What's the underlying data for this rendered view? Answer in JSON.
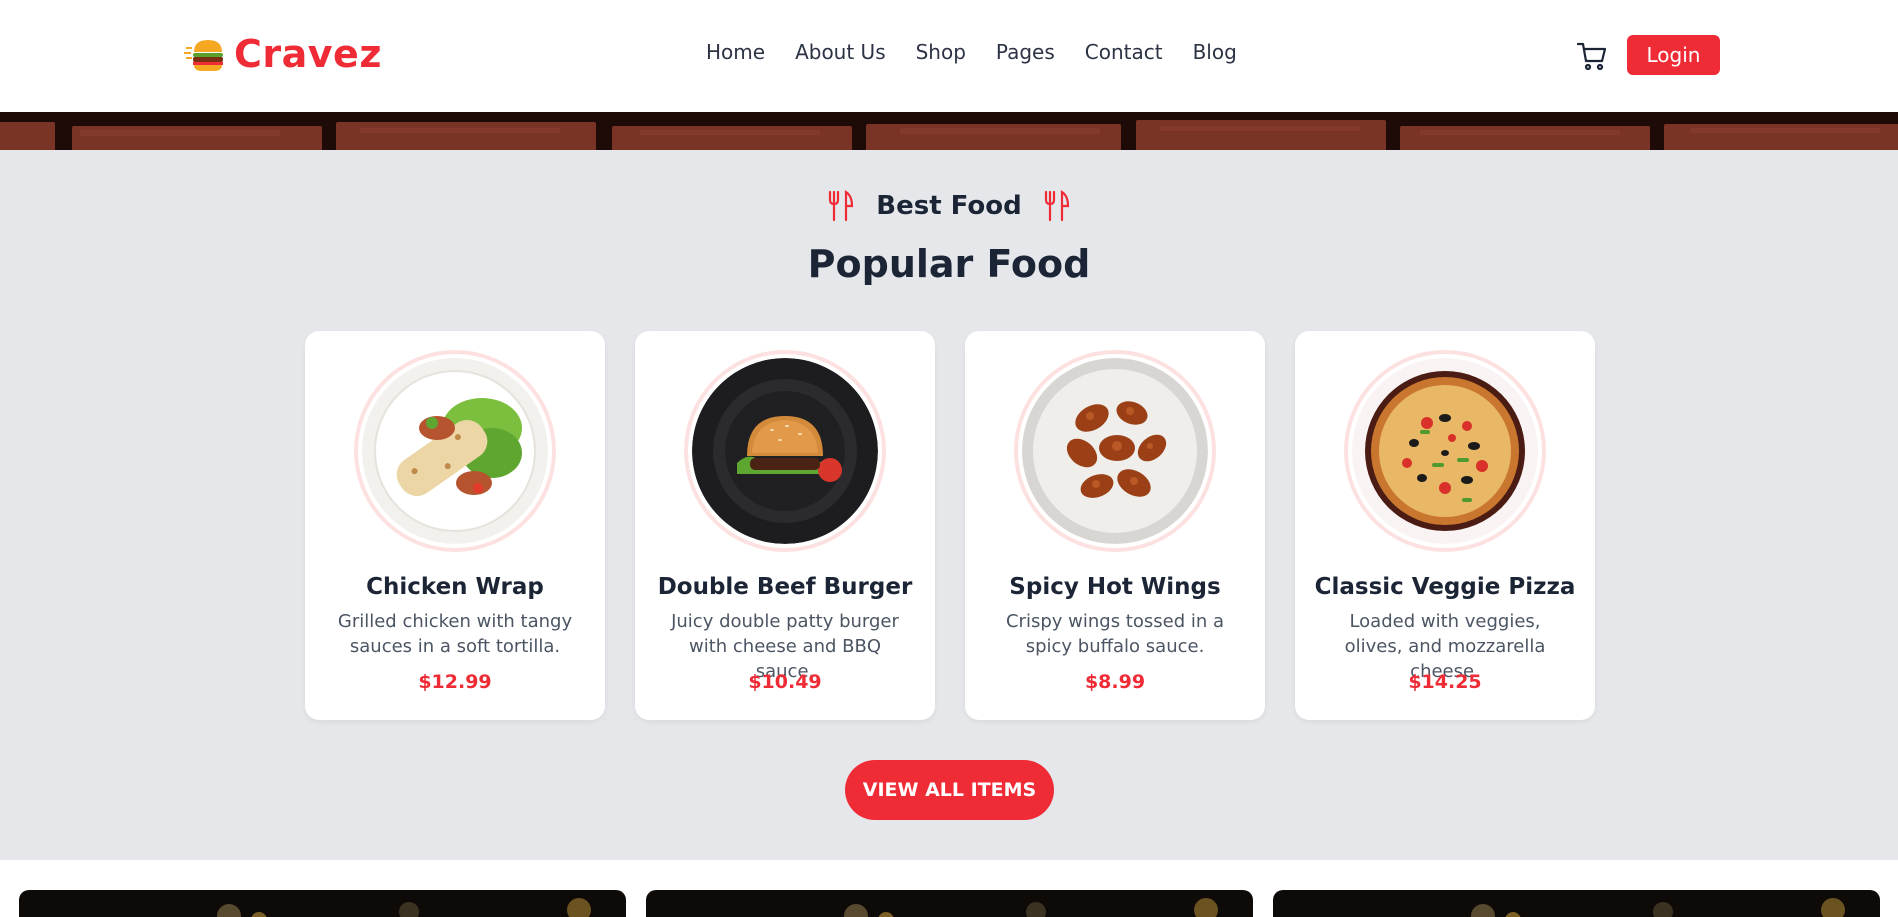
{
  "brand": {
    "name": "Cravez"
  },
  "nav": {
    "items": [
      "Home",
      "About Us",
      "Shop",
      "Pages",
      "Contact",
      "Blog"
    ]
  },
  "header": {
    "login_label": "Login"
  },
  "section": {
    "eyebrow": "Best Food",
    "title": "Popular Food",
    "cta": "VIEW ALL ITEMS"
  },
  "products": [
    {
      "name": "Chicken Wrap",
      "description": "Grilled chicken with tangy sauces in a soft tortilla.",
      "price": "$12.99"
    },
    {
      "name": "Double Beef Burger",
      "description": "Juicy double patty burger with cheese and BBQ sauce.",
      "price": "$10.49"
    },
    {
      "name": "Spicy Hot Wings",
      "description": "Crispy wings tossed in a spicy buffalo sauce.",
      "price": "$8.99"
    },
    {
      "name": "Classic Veggie Pizza",
      "description": "Loaded with veggies, olives, and mozzarella cheese.",
      "price": "$14.25"
    }
  ],
  "colors": {
    "accent": "#ef2b36",
    "text": "#1c2536",
    "background": "#e5e7eb"
  }
}
